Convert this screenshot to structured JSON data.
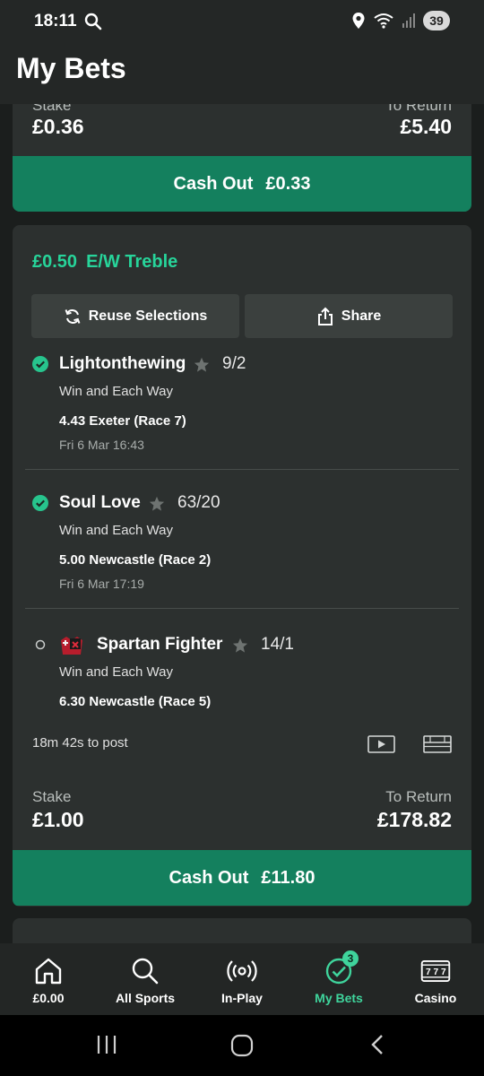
{
  "status_bar": {
    "time": "18:11",
    "battery": "39"
  },
  "page_title": "My Bets",
  "bet1": {
    "stake_label": "Stake",
    "stake": "£0.36",
    "return_label": "To Return",
    "return": "£5.40",
    "cashout_label": "Cash Out",
    "cashout_amount": "£0.33"
  },
  "bet2": {
    "stake_amount": "£0.50",
    "bet_type": "E/W Treble",
    "reuse_label": "Reuse Selections",
    "share_label": "Share",
    "selections": [
      {
        "name": "Lightonthewing",
        "odds": "9/2",
        "type": "Win and Each Way",
        "race": "4.43 Exeter (Race 7)",
        "time": "Fri 6 Mar 16:43",
        "status": "won"
      },
      {
        "name": "Soul Love",
        "odds": "63/20",
        "type": "Win and Each Way",
        "race": "5.00 Newcastle (Race 2)",
        "time": "Fri 6 Mar 17:19",
        "status": "won"
      },
      {
        "name": "Spartan Fighter",
        "odds": "14/1",
        "type": "Win and Each Way",
        "race": "6.30 Newcastle (Race 5)",
        "time": "",
        "status": "open"
      }
    ],
    "post_time": "18m 42s to post",
    "stake_label": "Stake",
    "stake": "£1.00",
    "return_label": "To Return",
    "return": "£178.82",
    "cashout_label": "Cash Out",
    "cashout_amount": "£11.80"
  },
  "nav": {
    "items": [
      {
        "label": "£0.00",
        "icon": "home-icon"
      },
      {
        "label": "All Sports",
        "icon": "search-icon"
      },
      {
        "label": "In-Play",
        "icon": "broadcast-icon"
      },
      {
        "label": "My Bets",
        "icon": "check-circle-icon",
        "badge": "3"
      },
      {
        "label": "Casino",
        "icon": "slot-machine-icon"
      }
    ]
  },
  "colors": {
    "accent": "#27d49a",
    "cashout": "#14805e",
    "card": "#2c302f"
  }
}
